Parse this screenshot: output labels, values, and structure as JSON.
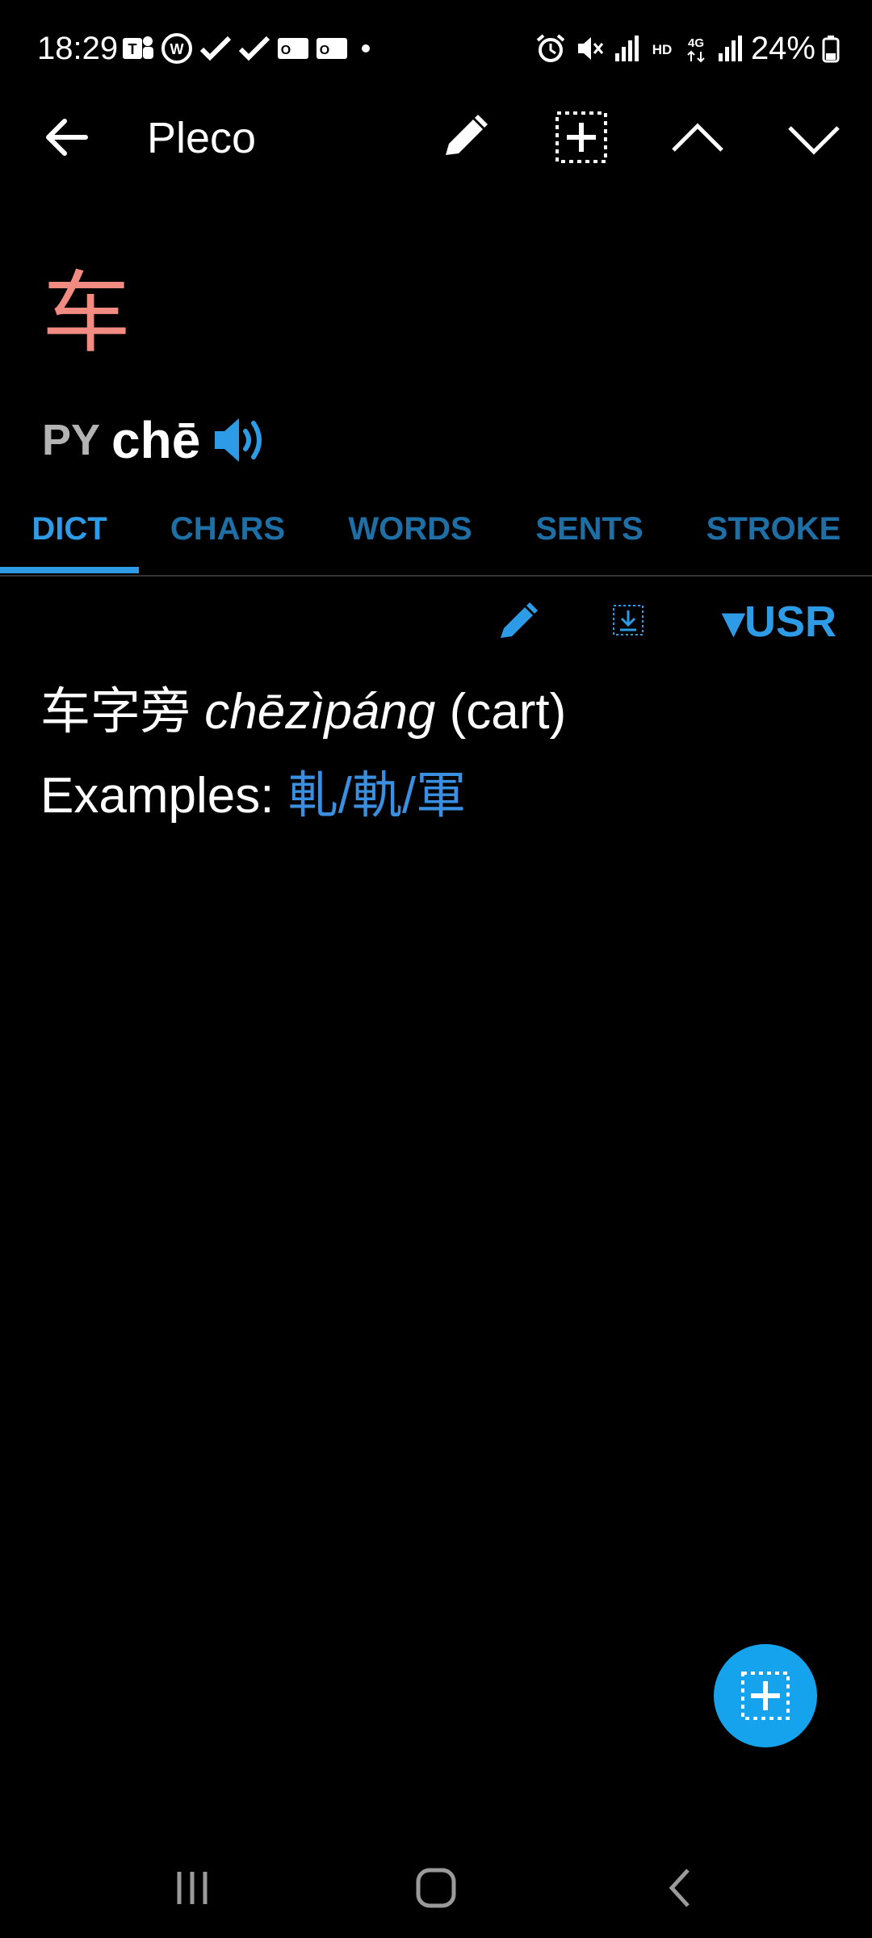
{
  "status_bar": {
    "time": "18:29",
    "notification_icons": [
      "teams-icon",
      "whatsapp-icon",
      "check-icon",
      "check-icon",
      "outlook-icon",
      "outlook-icon",
      "dot-icon"
    ],
    "system_icons": [
      "alarm-icon",
      "mute-icon",
      "signal-r-icon",
      "hd-icon",
      "4g-icon",
      "signal-icon"
    ],
    "battery": "24%"
  },
  "app_bar": {
    "title": "Pleco",
    "icons": [
      "back-arrow-icon",
      "pencil-icon",
      "add-flashcard-icon",
      "chevron-up-icon",
      "chevron-down-icon"
    ]
  },
  "entry": {
    "headword": "车",
    "py_label": "PY",
    "pinyin": "chē",
    "headword_color": "#f28b82"
  },
  "tabs": [
    {
      "label": "DICT"
    },
    {
      "label": "CHARS"
    },
    {
      "label": "WORDS"
    },
    {
      "label": "SENTS"
    },
    {
      "label": "STROKE"
    }
  ],
  "entry_toolbar": {
    "dictionary": "▾USR"
  },
  "definition": {
    "radical": "车字旁",
    "pinyin": "chēzìpáng",
    "gloss": "(cart)",
    "examples_label": "Examples:",
    "examples": "軋/軌/軍"
  },
  "colors": {
    "accent": "#2e9be6",
    "tab_inactive": "#1e6fa6",
    "fab": "#14a3ec",
    "link": "#3a8fe0"
  }
}
